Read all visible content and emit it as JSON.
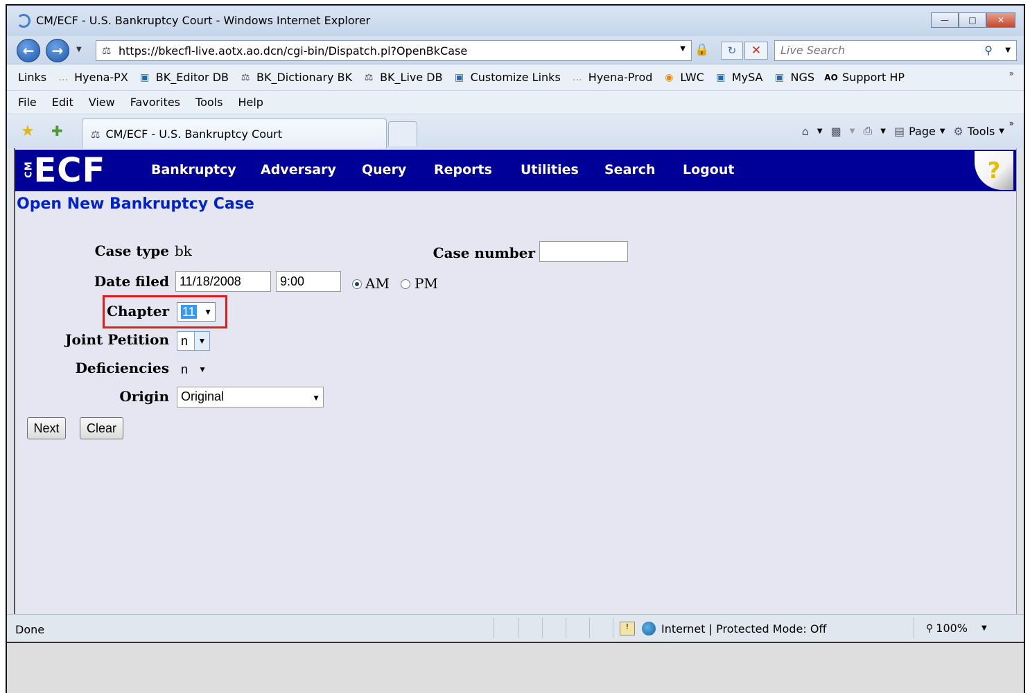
{
  "window": {
    "title": "CM/ECF - U.S. Bankruptcy Court - Windows Internet Explorer",
    "buttons": {
      "minimize": "—",
      "maximize": "□",
      "close": "✕"
    }
  },
  "address_bar": {
    "url": "https://bkecfl-live.aotx.ao.dcn/cgi-bin/Dispatch.pl?OpenBkCase",
    "search_placeholder": "Live Search"
  },
  "links_bar": {
    "items": [
      {
        "label": "Links",
        "icon": ""
      },
      {
        "label": "Hyena-PX",
        "icon": "hyena-icon"
      },
      {
        "label": "BK_Editor DB",
        "icon": "ie-page-icon"
      },
      {
        "label": "BK_Dictionary BK",
        "icon": "scales-icon"
      },
      {
        "label": "BK_Live DB",
        "icon": "scales-icon"
      },
      {
        "label": "Customize Links",
        "icon": "ie-page-icon"
      },
      {
        "label": "Hyena-Prod",
        "icon": "hyena-icon"
      },
      {
        "label": "LWC",
        "icon": "lwc-icon"
      },
      {
        "label": "MySA",
        "icon": "ie-page-icon"
      },
      {
        "label": "NGS",
        "icon": "ie-page-icon"
      },
      {
        "label": "Support HP",
        "icon": "ao-icon"
      }
    ]
  },
  "menu_bar": {
    "items": [
      "File",
      "Edit",
      "View",
      "Favorites",
      "Tools",
      "Help"
    ]
  },
  "tab": {
    "title": "CM/ECF - U.S. Bankruptcy Court"
  },
  "command_bar": {
    "page": "Page",
    "tools": "Tools"
  },
  "ecf": {
    "logo": "ECF",
    "logo_cm": "CM",
    "nav": [
      "Bankruptcy",
      "Adversary",
      "Query",
      "Reports",
      "Utilities",
      "Search",
      "Logout"
    ],
    "help": "?"
  },
  "form": {
    "title": "Open New Bankruptcy Case",
    "case_type_label": "Case type",
    "case_type_value": "bk",
    "case_number_label": "Case number",
    "case_number_value": "",
    "date_filed_label": "Date filed",
    "date_value": "11/18/2008",
    "time_value": "9:00",
    "am_label": "AM",
    "pm_label": "PM",
    "ampm_selected": "AM",
    "chapter_label": "Chapter",
    "chapter_value": "11",
    "joint_petition_label": "Joint Petition",
    "joint_petition_value": "n",
    "deficiencies_label": "Deficiencies",
    "deficiencies_value": "n",
    "origin_label": "Origin",
    "origin_value": "Original",
    "next_button": "Next",
    "clear_button": "Clear"
  },
  "status_bar": {
    "status": "Done",
    "zone": "Internet | Protected Mode: Off",
    "zoom": "100%"
  },
  "colors": {
    "ecf_banner": "#000099",
    "page_title": "#0022cc",
    "page_bg": "#e6e6f3",
    "highlight": "#e21b1b"
  }
}
